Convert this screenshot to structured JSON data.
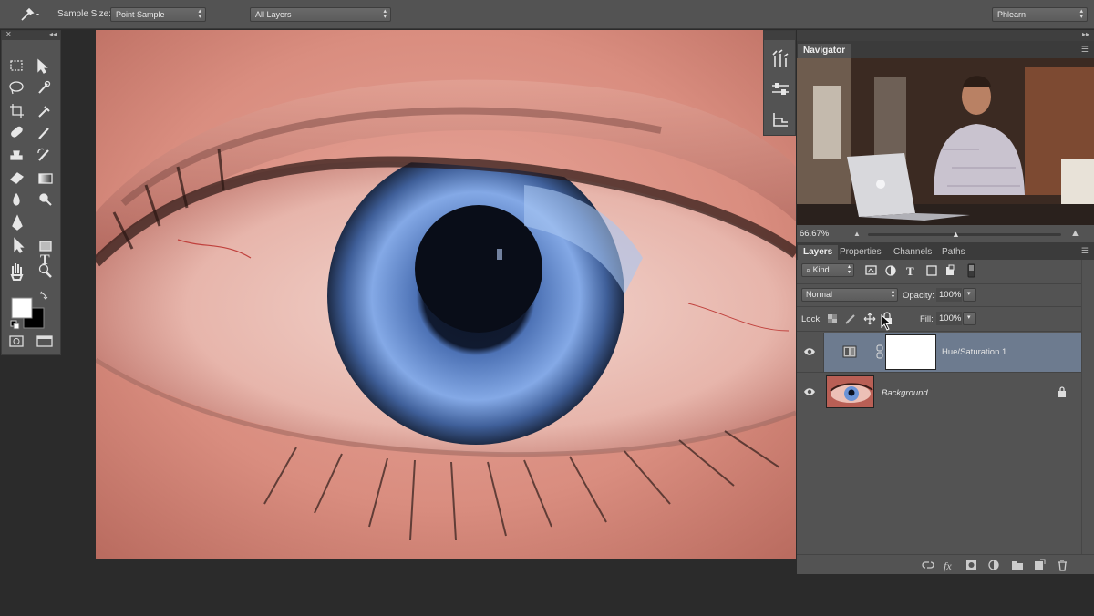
{
  "options_bar": {
    "sample_size_label": "Sample Size:",
    "sample_size_value": "Point Sample",
    "sample_layers_value": "All Layers",
    "workspace_value": "Phlearn"
  },
  "navigator": {
    "tab_label": "Navigator",
    "zoom": "66.67%"
  },
  "layers_panel": {
    "tabs": [
      "Layers",
      "Properties",
      "Channels",
      "Paths"
    ],
    "filter_label": "Kind",
    "blend_mode": "Normal",
    "opacity_label": "Opacity:",
    "opacity_value": "100%",
    "lock_label": "Lock:",
    "fill_label": "Fill:",
    "fill_value": "100%",
    "layers": [
      {
        "name": "Hue/Saturation 1",
        "selected": true
      },
      {
        "name": "Background",
        "selected": false
      }
    ]
  },
  "colors": {
    "panel": "#535353",
    "selected_layer": "#6d7b8f",
    "iris": "#6b93d6"
  }
}
